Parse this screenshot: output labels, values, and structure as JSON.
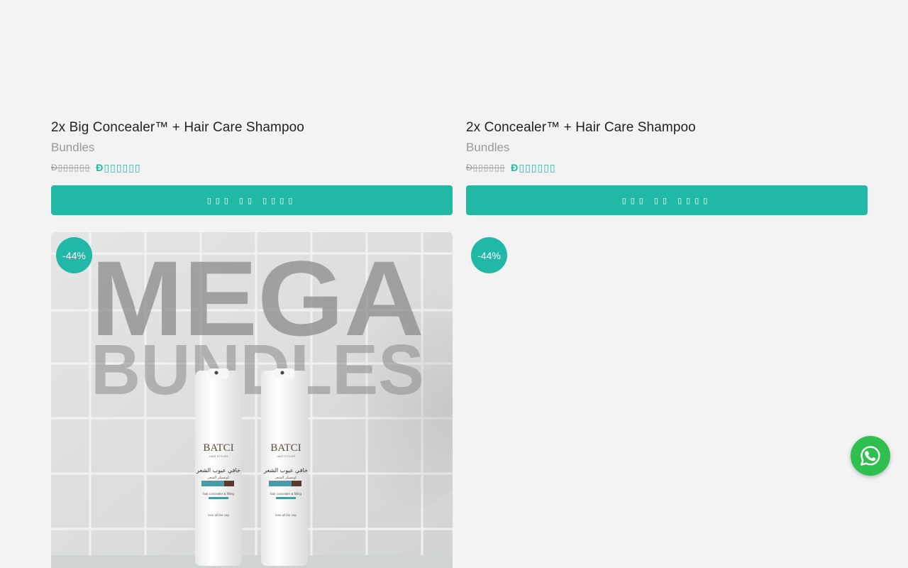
{
  "products": [
    {
      "title": "2x Big Concealer™ + Hair Care Shampoo",
      "category": "Bundles",
      "price_old": "Đ▯▯▯▯▯▯",
      "price_new": "Đ▯▯▯▯▯▯",
      "button_label": "▯▯▯ ▯▯ ▯▯▯▯"
    },
    {
      "title": "2x Concealer™ + Hair Care Shampoo",
      "category": "Bundles",
      "price_old": "Đ▯▯▯▯▯▯",
      "price_new": "Đ▯▯▯▯▯▯",
      "button_label": "▯▯▯ ▯▯ ▯▯▯▯"
    }
  ],
  "lower_cards": [
    {
      "badge": "-44%",
      "image": {
        "headline_1": "MEGA",
        "headline_2": "BUNDLES",
        "bottle_brand": "BATCI",
        "bottle_subtitle": "HAIR STYLER",
        "bottle_arabic": "خافي عيوب الشعر",
        "bottle_arabic_2": "كونسيلر الشعر",
        "bottle_desc": "hair concealer & filling",
        "bottle_tag": "lose all the cap"
      }
    },
    {
      "badge": "-44%"
    }
  ],
  "whatsapp": {
    "icon": "whatsapp-icon"
  },
  "colors": {
    "accent": "#21b8a6",
    "background": "#f3f3f3",
    "whatsapp": "#2fbf4f"
  }
}
